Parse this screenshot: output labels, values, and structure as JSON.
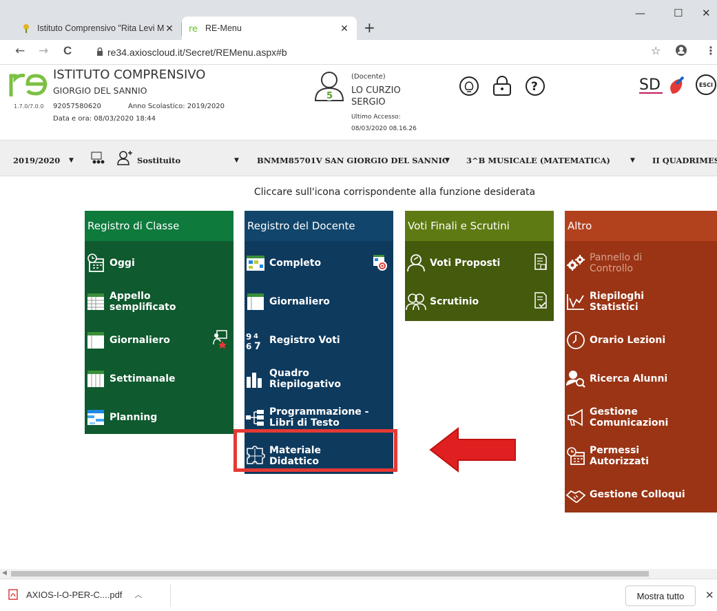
{
  "browser": {
    "tabs": [
      {
        "title": "Istituto Comprensivo \"Rita Levi M",
        "close": "✕"
      },
      {
        "title": "RE-Menu",
        "close": "✕"
      }
    ],
    "new_tab": "+",
    "window_controls": {
      "minimize": "—",
      "maximize": "☐",
      "close": "✕"
    },
    "url": "re34.axioscloud.it/Secret/REMenu.aspx#b",
    "nav": {
      "back": "←",
      "forward": "→",
      "reload": "C"
    },
    "right_icons": {
      "star": "☆",
      "menu": "⋮"
    }
  },
  "header": {
    "version": "1.7.0/7.0.0",
    "school_line1": "ISTITUTO COMPRENSIVO",
    "school_line2": "GIORGIO DEL SANNIO",
    "codice": "92057580620",
    "anno": "Anno Scolastico: 2019/2020",
    "dataora": "Data e ora: 08/03/2020 18:44",
    "user_badge": "5",
    "role": "(Docente)",
    "user_name1": "LO CURZIO",
    "user_name2": "SERGIO",
    "last_access_label": "Ultimo Accesso:",
    "last_access_value": "08/03/2020 08.16.26",
    "esci": "ESCI"
  },
  "selbar": {
    "year": "2019/2020",
    "sostituito": "Sostituito",
    "school": "BNMM85701V SAN GIORGIO DEL SANNIC",
    "classe": "3^B MUSICALE (MATEMATICA)",
    "periodo": "II QUADRIMES",
    "arrow": "▼"
  },
  "instruction": "Cliccare sull'icona corrispondente alla funzione desiderata",
  "columns": {
    "registro_classe": {
      "title": "Registro di Classe",
      "items": [
        "Oggi",
        "Appello semplificato",
        "Giornaliero",
        "Settimanale",
        "Planning"
      ]
    },
    "registro_docente": {
      "title": "Registro del Docente",
      "items": [
        "Completo",
        "Giornaliero",
        "Registro Voti",
        "Quadro Riepilogativo",
        "Programmazione - Libri di Testo",
        "Materiale Didattico"
      ]
    },
    "voti_finali": {
      "title": "Voti Finali e Scrutini",
      "items": [
        "Voti Proposti",
        "Scrutinio"
      ]
    },
    "altro": {
      "title": "Altro",
      "items": [
        "Pannello di Controllo",
        "Riepiloghi Statistici",
        "Orario Lezioni",
        "Ricerca Alunni",
        "Gestione Comunicazioni",
        "Permessi Autorizzati",
        "Gestione Colloqui"
      ]
    }
  },
  "downloads": {
    "file": "AXIOS-I-O-PER-C....pdf",
    "show_all": "Mostra tutto",
    "close": "✕"
  },
  "colors": {
    "green": "#0f5a2e",
    "blue": "#0e3a5e",
    "olive": "#445a0c",
    "rust": "#9a3415",
    "highlight": "#e53935"
  }
}
